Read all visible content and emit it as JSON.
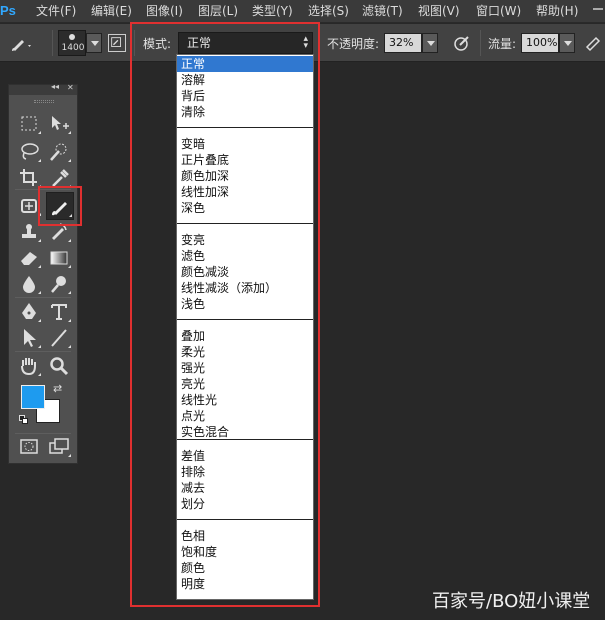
{
  "app": {
    "logo_text": "Ps"
  },
  "menu": [
    {
      "label": "文件(F)"
    },
    {
      "label": "编辑(E)"
    },
    {
      "label": "图像(I)"
    },
    {
      "label": "图层(L)"
    },
    {
      "label": "类型(Y)"
    },
    {
      "label": "选择(S)"
    },
    {
      "label": "滤镜(T)"
    },
    {
      "label": "视图(V)"
    },
    {
      "label": "窗口(W)"
    },
    {
      "label": "帮助(H)"
    }
  ],
  "options_bar": {
    "brush_size": "1400",
    "mode_label": "模式:",
    "mode_value": "正常",
    "opacity_label": "不透明度:",
    "opacity_value": "32%",
    "flow_label": "流量:",
    "flow_value": "100%"
  },
  "toolbox": {
    "header_collapse": "◂◂",
    "header_close": "✕"
  },
  "mode_list": {
    "groups": [
      [
        "正常",
        "溶解",
        "背后",
        "清除"
      ],
      [
        "变暗",
        "正片叠底",
        "颜色加深",
        "线性加深",
        "深色"
      ],
      [
        "变亮",
        "滤色",
        "颜色减淡",
        "线性减淡（添加）",
        "浅色"
      ],
      [
        "叠加",
        "柔光",
        "强光",
        "亮光",
        "线性光",
        "点光",
        "实色混合"
      ],
      [
        "差值",
        "排除",
        "减去",
        "划分"
      ],
      [
        "色相",
        "饱和度",
        "颜色",
        "明度"
      ]
    ],
    "selected": "正常"
  },
  "colors": {
    "foreground": "#1e9bef",
    "background": "#ffffff",
    "highlight": "#e03030",
    "selection": "#3078d0"
  },
  "watermark": "百家号/BO妞小课堂"
}
